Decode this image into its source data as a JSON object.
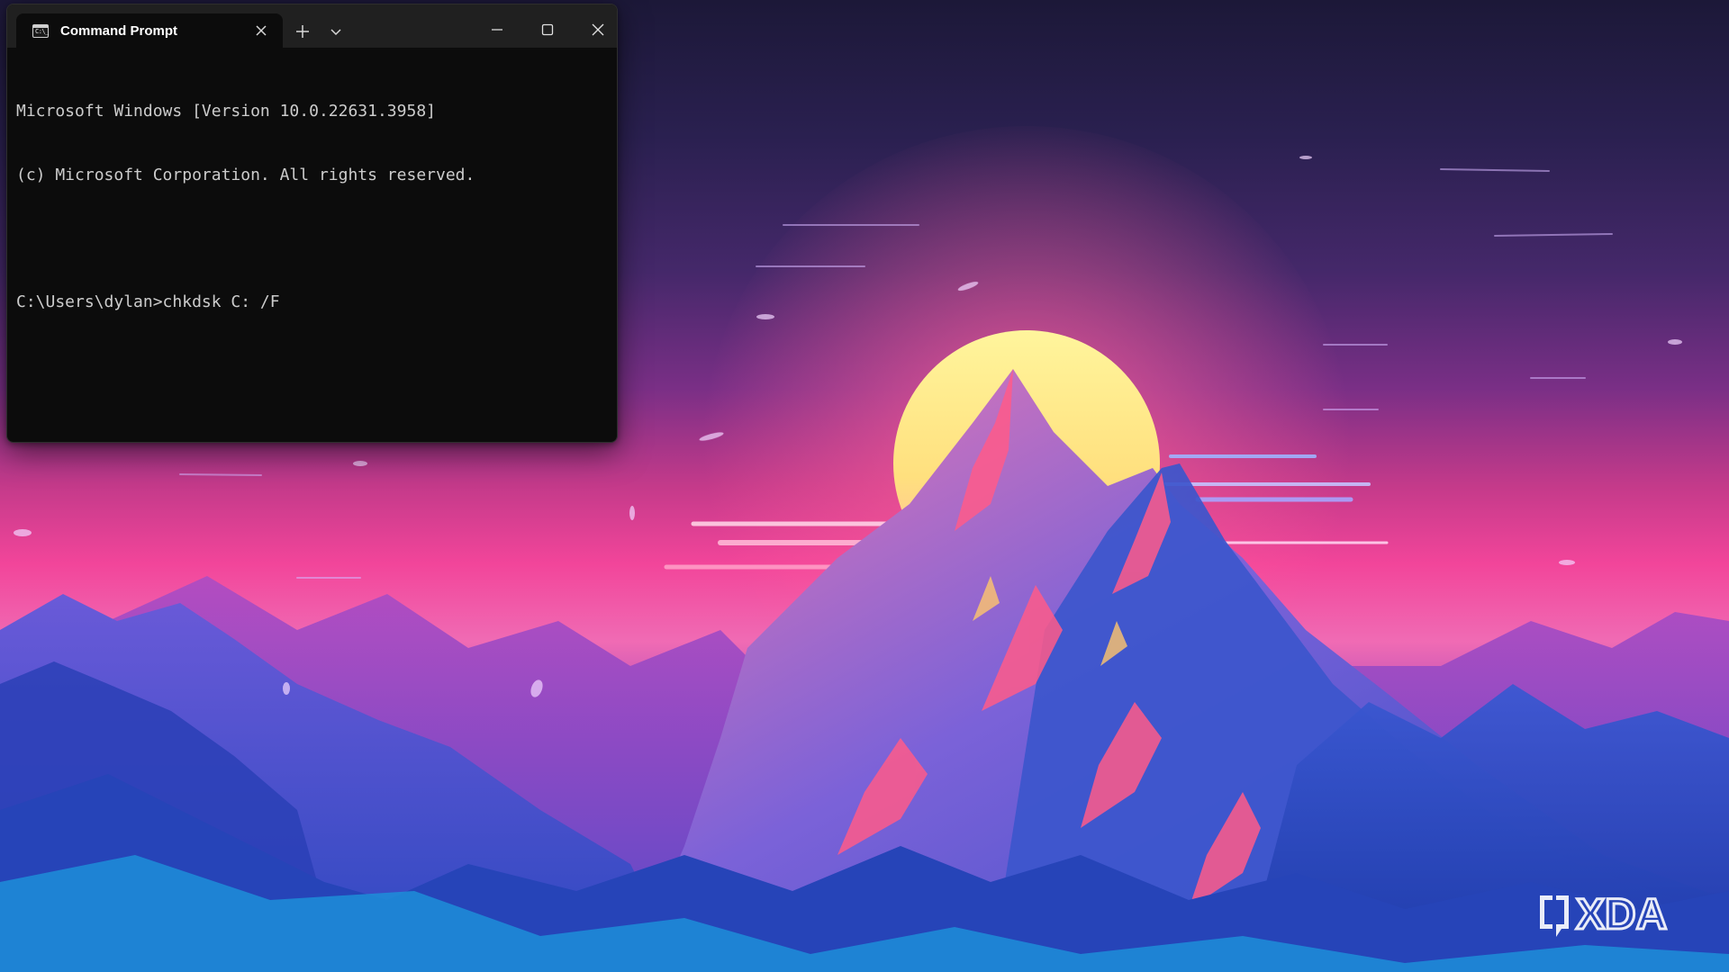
{
  "desktop": {
    "wallpaper_colors": {
      "sky_top": "#1c1838",
      "sky_mid": "#7a2f86",
      "horizon_pink": "#f2459a",
      "sun": "#fff3a0",
      "mountain_blue": "#3f55cc",
      "mountain_highlight": "#ff5a86"
    }
  },
  "terminal": {
    "tab": {
      "title": "Command Prompt",
      "icon": "command-prompt-icon",
      "icon_glyph": "C:\\_"
    },
    "controls": {
      "new_tab_icon": "plus-icon",
      "dropdown_icon": "chevron-down-icon",
      "minimize_icon": "minimize-icon",
      "maximize_icon": "maximize-icon",
      "close_icon": "close-icon"
    },
    "lines": [
      "Microsoft Windows [Version 10.0.22631.3958]",
      "(c) Microsoft Corporation. All rights reserved.",
      "",
      "C:\\Users\\dylan>chkdsk C: /F"
    ],
    "background": "#0c0c0c",
    "text_color": "#cccccc",
    "titlebar_color": "#202020"
  },
  "watermark": {
    "text": "XDA",
    "logo_icon": "xda-logo-icon"
  }
}
